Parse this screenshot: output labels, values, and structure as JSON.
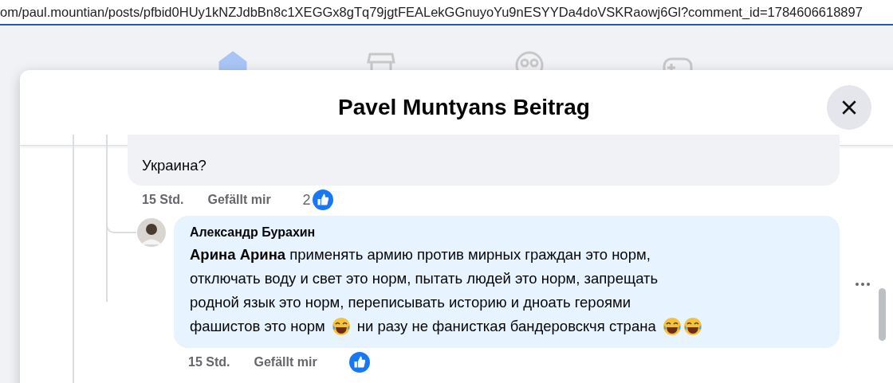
{
  "address_bar": {
    "url": "om/paul.mountian/posts/pfbid0HUy1kNZJdbBn8c1XEGGx8gTq79jgtFEALekGGnuyoYu9nESYYDa4doVSKRaowj6Gl?comment_id=1784606618897"
  },
  "nav": [
    {
      "kind": "home",
      "selected": true
    },
    {
      "kind": "store",
      "selected": false
    },
    {
      "kind": "groups",
      "selected": false
    },
    {
      "kind": "games",
      "selected": false
    }
  ],
  "dialog": {
    "title": "Pavel Muntyans Beitrag"
  },
  "comments": [
    {
      "kind": "cut",
      "lines": [
        [
          {
            "kind": "text",
            "text": "Украина?"
          }
        ]
      ],
      "time": "15 Std.",
      "like": "Gefällt mir",
      "reactions": "2"
    },
    {
      "kind": "reply",
      "author": "Александр Бурахин",
      "lines": [
        [
          {
            "kind": "text",
            "text": "**Арина Арина** применять армию против мирных граждан это норм,"
          }
        ],
        [
          {
            "kind": "text",
            "text": "отключать воду и свет это норм, пытать людей это норм, запрещать"
          }
        ],
        [
          {
            "kind": "text",
            "text": "родной язык это норм, переписывать историю и дноать героями"
          }
        ],
        [
          {
            "kind": "text",
            "text": "фашистов это норм"
          },
          {
            "kind": "emoji"
          },
          {
            "kind": "text",
            "text": "ни разу не фанисткая бандеровскчя страна"
          },
          {
            "kind": "emoji"
          },
          {
            "kind": "emoji"
          }
        ]
      ],
      "time": "15 Std.",
      "like": "Gefällt mir"
    }
  ]
}
